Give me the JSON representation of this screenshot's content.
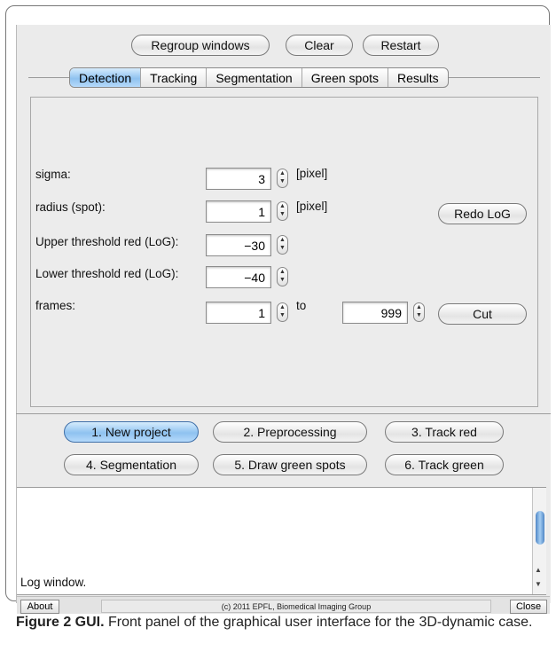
{
  "toolbar": {
    "regroup_label": "Regroup windows",
    "clear_label": "Clear",
    "restart_label": "Restart"
  },
  "tabs": [
    {
      "label": "Detection",
      "active": true
    },
    {
      "label": "Tracking",
      "active": false
    },
    {
      "label": "Segmentation",
      "active": false
    },
    {
      "label": "Green spots",
      "active": false
    },
    {
      "label": "Results",
      "active": false
    }
  ],
  "detection": {
    "sigma": {
      "label": "sigma:",
      "value": "3",
      "unit": "[pixel]"
    },
    "radius": {
      "label": "radius (spot):",
      "value": "1",
      "unit": "[pixel]"
    },
    "upper": {
      "label": "Upper threshold red (LoG):",
      "value": "−30"
    },
    "lower": {
      "label": "Lower threshold red (LoG):",
      "value": "−40"
    },
    "frames": {
      "label": "frames:",
      "from": "1",
      "to_label": "to",
      "to": "999"
    },
    "redo_label": "Redo LoG",
    "cut_label": "Cut"
  },
  "workflow": {
    "new_project": "1. New project",
    "preprocessing": "2. Preprocessing",
    "track_red": "3. Track red",
    "segmentation": "4. Segmentation",
    "draw_green": "5. Draw green spots",
    "track_green": "6. Track green"
  },
  "log": {
    "text": "Log window."
  },
  "status": {
    "about_label": "About",
    "copyright": "(c) 2011 EPFL, Biomedical Imaging Group",
    "close_label": "Close"
  },
  "caption": {
    "figure": "Figure 2 GUI.",
    "text": " Front panel of the graphical user interface for the 3D-dynamic case."
  },
  "colors": {
    "accent": "#8fc2f0",
    "window_bg": "#ebebeb"
  }
}
